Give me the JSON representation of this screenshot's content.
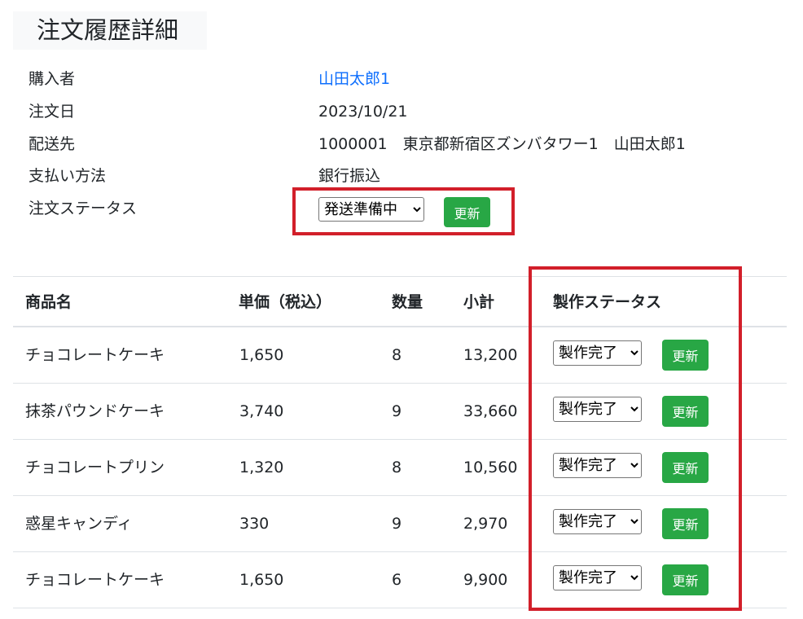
{
  "page": {
    "title": "注文履歴詳細"
  },
  "order_info": {
    "buyer_label": "購入者",
    "buyer_value": "山田太郎1",
    "date_label": "注文日",
    "date_value": "2023/10/21",
    "address_label": "配送先",
    "address_value": "1000001　東京都新宿区ズンバタワー1　山田太郎1",
    "payment_label": "支払い方法",
    "payment_value": "銀行振込",
    "status_label": "注文ステータス",
    "status_value": "発送準備中",
    "update_label": "更新"
  },
  "table": {
    "headers": [
      "商品名",
      "単価（税込）",
      "数量",
      "小計",
      "製作ステータス"
    ],
    "rows": [
      {
        "name": "チョコレートケーキ",
        "price": "1,650",
        "qty": "8",
        "subtotal": "13,200",
        "status": "製作完了",
        "update": "更新"
      },
      {
        "name": "抹茶パウンドケーキ",
        "price": "3,740",
        "qty": "9",
        "subtotal": "33,660",
        "status": "製作完了",
        "update": "更新"
      },
      {
        "name": "チョコレートプリン",
        "price": "1,320",
        "qty": "8",
        "subtotal": "10,560",
        "status": "製作完了",
        "update": "更新"
      },
      {
        "name": "惑星キャンディ",
        "price": "330",
        "qty": "9",
        "subtotal": "2,970",
        "status": "製作完了",
        "update": "更新"
      },
      {
        "name": "チョコレートケーキ",
        "price": "1,650",
        "qty": "6",
        "subtotal": "9,900",
        "status": "製作完了",
        "update": "更新"
      }
    ]
  },
  "colors": {
    "accent_green": "#28a745",
    "highlight_red": "#d21f2a",
    "link_blue": "#0d6efd"
  }
}
